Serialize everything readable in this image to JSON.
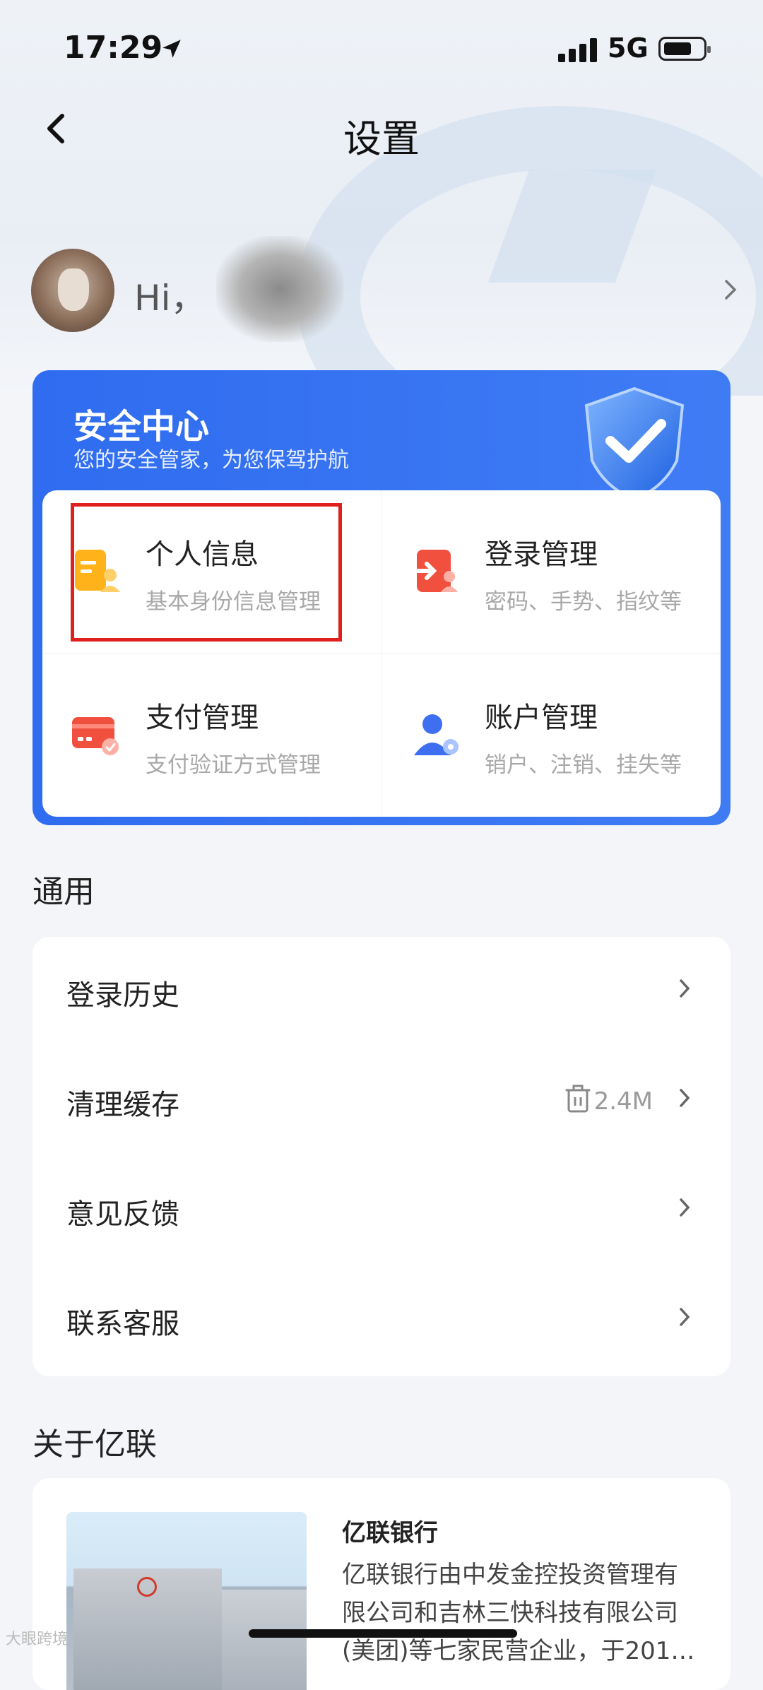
{
  "status_bar": {
    "time": "17:29",
    "network": "5G"
  },
  "nav": {
    "title": "设置"
  },
  "user": {
    "greeting": "Hi，"
  },
  "security": {
    "title": "安全中心",
    "subtitle": "您的安全管家，为您保驾护航",
    "tiles": [
      {
        "label": "个人信息",
        "desc": "基本身份信息管理",
        "icon": "document-icon"
      },
      {
        "label": "登录管理",
        "desc": "密码、手势、指纹等",
        "icon": "login-icon"
      },
      {
        "label": "支付管理",
        "desc": "支付验证方式管理",
        "icon": "card-icon"
      },
      {
        "label": "账户管理",
        "desc": "销户、注销、挂失等",
        "icon": "account-icon"
      }
    ]
  },
  "general": {
    "heading": "通用",
    "items": [
      {
        "label": "登录历史"
      },
      {
        "label": "清理缓存",
        "value": "2.4M"
      },
      {
        "label": "意见反馈"
      },
      {
        "label": "联系客服"
      }
    ]
  },
  "about": {
    "heading": "关于亿联",
    "name": "亿联银行",
    "desc": "亿联银行由中发金控投资管理有限公司和吉林三快科技有限公司(美团)等七家民营企业，于201…"
  },
  "watermark": "大眼跨境",
  "colors": {
    "accent": "#2f6cf0",
    "highlight": "#e0201c"
  }
}
